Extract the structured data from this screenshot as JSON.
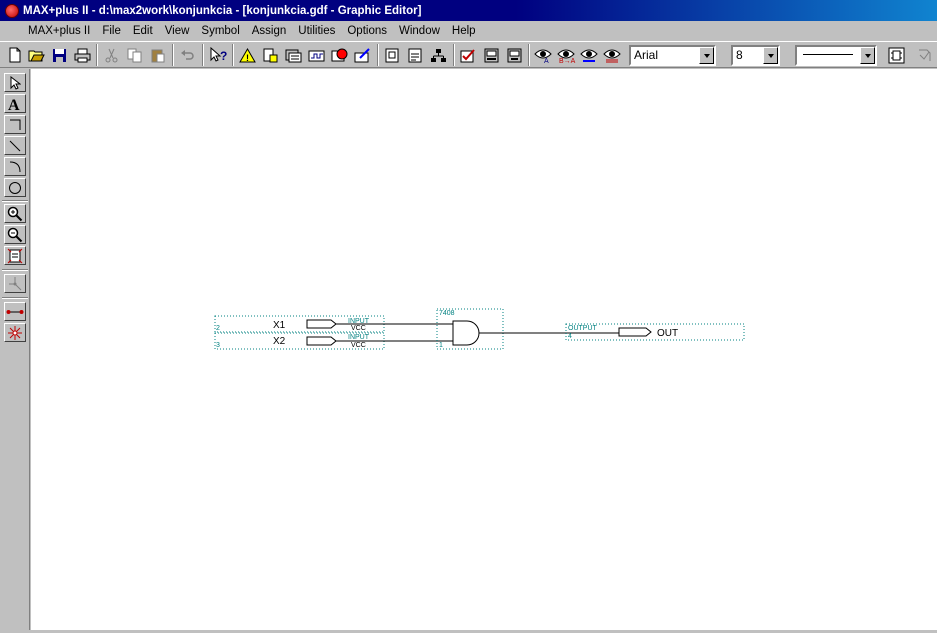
{
  "window": {
    "title": "MAX+plus II - d:\\max2work\\konjunkcia - [konjunkcia.gdf - Graphic Editor]"
  },
  "menu": {
    "items": [
      {
        "label": "MAX+plus II"
      },
      {
        "label": "File"
      },
      {
        "label": "Edit"
      },
      {
        "label": "View"
      },
      {
        "label": "Symbol"
      },
      {
        "label": "Assign"
      },
      {
        "label": "Utilities"
      },
      {
        "label": "Options"
      },
      {
        "label": "Window"
      },
      {
        "label": "Help"
      }
    ]
  },
  "toolbar": {
    "font_name": "Arial",
    "font_size": "8",
    "icons": [
      "new-icon",
      "open-icon",
      "save-icon",
      "print-icon",
      "cut-icon",
      "copy-icon",
      "paste-icon",
      "undo-icon",
      "help-pointer-icon",
      "compiler-warning-icon",
      "hierarchy-icon",
      "floorplan-icon",
      "simulator-icon",
      "timing-icon",
      "programmer-icon",
      "open-symbol-icon",
      "open-file-icon",
      "hierarchy-display-icon",
      "check-project-icon",
      "compile-icon",
      "simulate-icon",
      "find-node-icon",
      "find-text-icon",
      "find-replace-icon",
      "find-clear-icon",
      "line-style-icon",
      "rubberband-icon"
    ]
  },
  "palette": {
    "tools": [
      "selection-tool-icon",
      "text-tool-icon",
      "orthogonal-line-icon",
      "diagonal-line-icon",
      "arc-tool-icon",
      "circle-tool-icon",
      "zoom-in-icon",
      "zoom-out-icon",
      "fit-window-icon",
      "connect-dots-icon",
      "rubberbanding-on-icon",
      "rubberbanding-off-icon"
    ]
  },
  "schematic": {
    "input1": {
      "pin_number": "2",
      "name": "X1",
      "type": "INPUT",
      "default": "VCC"
    },
    "input2": {
      "pin_number": "3",
      "name": "X2",
      "type": "INPUT",
      "default": "VCC"
    },
    "gate": {
      "label": "7408",
      "instance": "1"
    },
    "output": {
      "pin_number": "4",
      "name": "OUT",
      "type": "OUTPUT"
    }
  },
  "colors": {
    "titlebar": "#000080",
    "annotation": "#008080",
    "canvas": "#ffffff"
  }
}
